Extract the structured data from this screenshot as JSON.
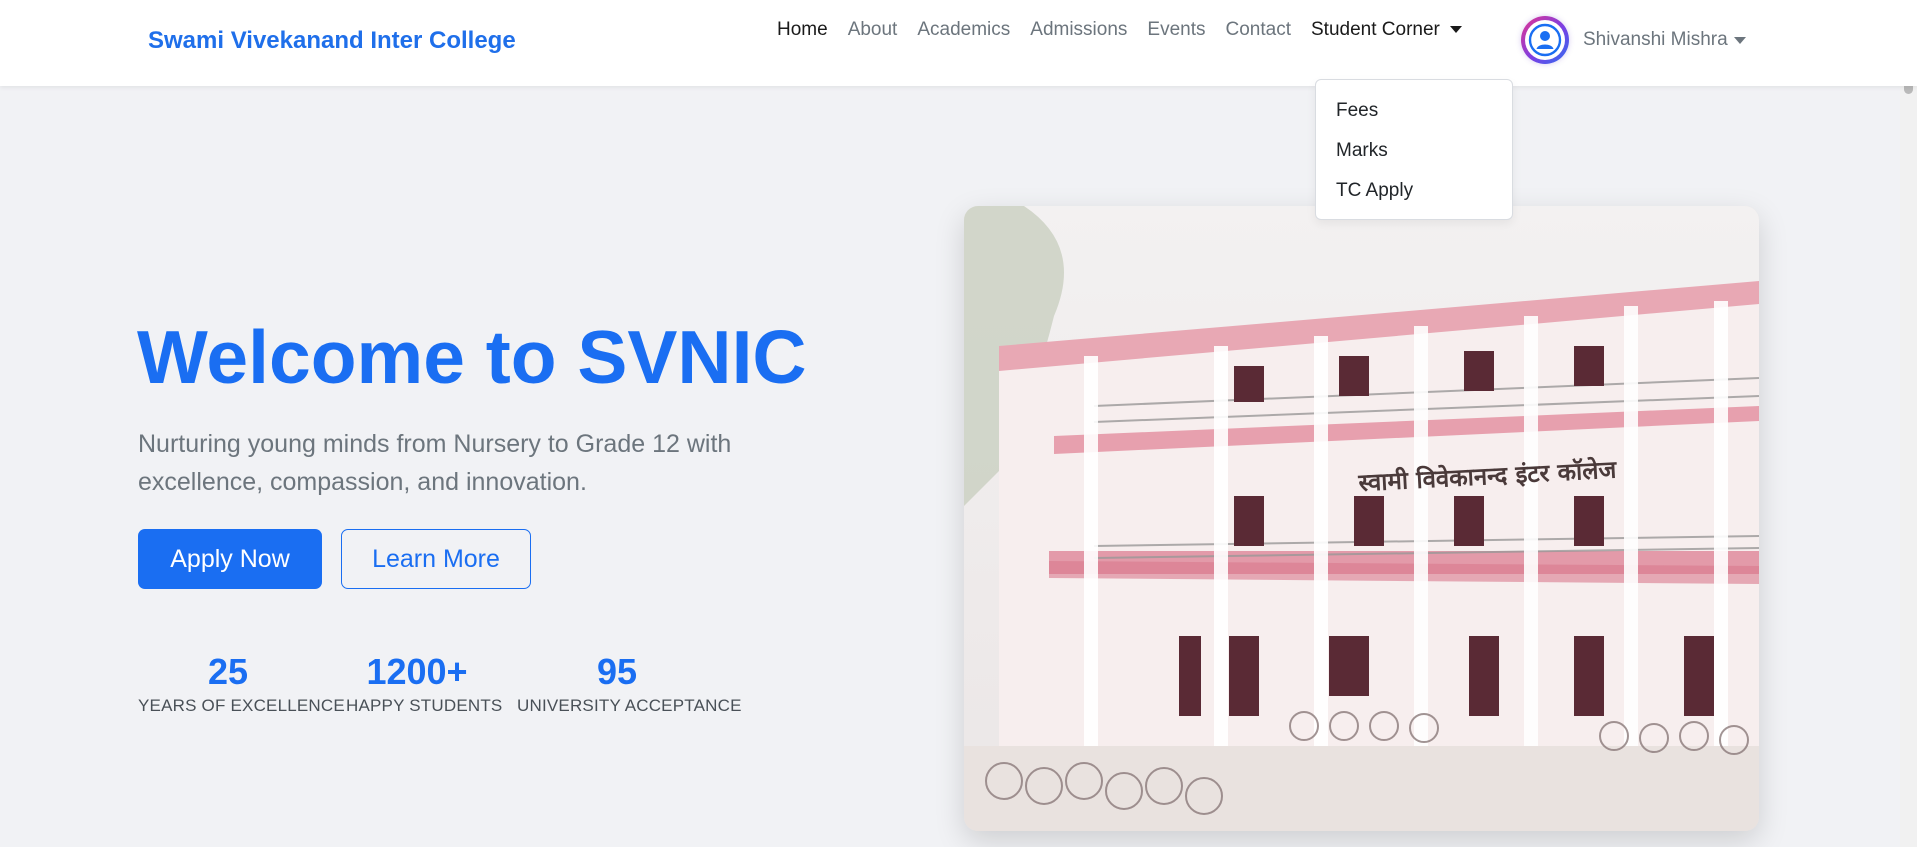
{
  "navbar": {
    "brand": "Swami Vivekanand Inter College",
    "links": [
      {
        "label": "Home"
      },
      {
        "label": "About"
      },
      {
        "label": "Academics"
      },
      {
        "label": "Admissions"
      },
      {
        "label": "Events"
      },
      {
        "label": "Contact"
      },
      {
        "label": "Student Corner"
      }
    ],
    "active_link": "Home",
    "profile_name": "Shivanshi Mishra",
    "avatar_icon": "user-avatar-icon"
  },
  "student_corner_menu": {
    "items": [
      {
        "label": "Fees"
      },
      {
        "label": "Marks"
      },
      {
        "label": "TC Apply"
      }
    ]
  },
  "hero": {
    "title": "Welcome to SVNIC",
    "subtitle": "Nurturing young minds from Nursery to Grade 12 with excellence, compassion, and innovation.",
    "primary_button": "Apply Now",
    "secondary_button": "Learn More",
    "stats": [
      {
        "value": "25",
        "label": "YEARS OF EXCELLENCE"
      },
      {
        "value": "1200+",
        "label": "HAPPY STUDENTS"
      },
      {
        "value": "95",
        "label": "UNIVERSITY ACCEPTANCE"
      }
    ],
    "image_sign_text": "स्वामी विवेकानन्द इंटर कॉलेज"
  },
  "colors": {
    "brand": "#1f6fea",
    "primary": "#1a6ef2",
    "muted": "#6c757d",
    "background": "#f1f2f5"
  }
}
